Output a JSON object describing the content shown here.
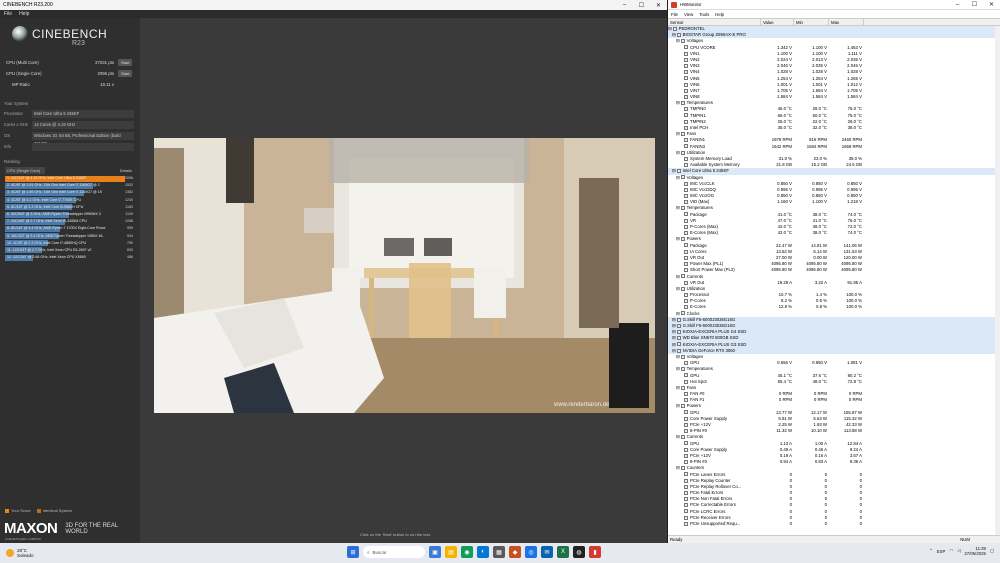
{
  "cinebench": {
    "title": "CINEBENCH R23.200",
    "menu": [
      "File",
      "Help"
    ],
    "logo": "CINEBENCH",
    "version": "R23",
    "multi": {
      "label": "CPU (Multi Core)",
      "value": "27031 pts",
      "btn": "Start"
    },
    "single": {
      "label": "CPU (Single Core)",
      "value": "2096 pts",
      "btn": "Start"
    },
    "ratio": {
      "label": "MP Ratio",
      "value": "10.11 x"
    },
    "system_label": "Your System",
    "system": [
      {
        "k": "Processor",
        "v": "Intel Core Ultra 5 245KF"
      },
      {
        "k": "Cores x GHz",
        "v": "14 Cores @ 4.19 GHz"
      },
      {
        "k": "OS",
        "v": "Windows 10, 64 Bit, Professional Edition (build 26100)"
      },
      {
        "k": "Info",
        "v": ""
      }
    ],
    "ranking_label": "Ranking",
    "ranking_dropdown": "CPU (Single Core)",
    "details": "Details",
    "ranking": [
      {
        "t": "1. 14C/14T @ 4.19 GHz, Intel Core Ultra 5 245KF",
        "s": "2096",
        "me": true,
        "f": 1.0
      },
      {
        "t": "2. 4C/8T @ 2.81 GHz, 11th Gen Intel Core i7-1165G7 @ 2",
        "s": "1532",
        "f": 0.73
      },
      {
        "t": "3. 4C/8T @ 1.69 GHz, 11th Gen Intel Core i7-1165G7 @ 15",
        "s": "1382",
        "f": 0.66
      },
      {
        "t": "4. 4C/8T @ 4.2 GHz, Intel Core i7-7700K CPU",
        "s": "1230",
        "f": 0.59
      },
      {
        "t": "5. 8C/16T @ 2.3 GHz, Intel Core i9-9880H CPU",
        "s": "1183",
        "f": 0.56
      },
      {
        "t": "6. 32C/64T @ 3 GHz, AMD Ryzen Threadripper 2990WX 3",
        "s": "1109",
        "f": 0.53
      },
      {
        "t": "7. 24C/48T @ 2.7 GHz, Intel Xeon W-3265M CPU",
        "s": "1058",
        "f": 0.5
      },
      {
        "t": "8. 8C/16T @ 3.4 GHz, AMD Ryzen 7 1700X Eight-Core Proce",
        "s": "959",
        "f": 0.46
      },
      {
        "t": "9. 16C/32T @ 3.4 GHz, AMD Ryzen Threadripper 1950X 16-",
        "s": "944",
        "f": 0.45
      },
      {
        "t": "10. 4C/8T @ 2.3 GHz, Intel Core i7-4850HQ CPU",
        "s": "750",
        "f": 0.36
      },
      {
        "t": "11. 12C/24T @ 2.7 GHz, Intel Xeon CPU E5-2697 v2",
        "s": "653",
        "f": 0.31
      },
      {
        "t": "12. 12C/24T @ 2.66 GHz, Intel Xeon CPU X5650",
        "s": "486",
        "f": 0.23
      }
    ],
    "legend": [
      "Your Score",
      "Identical System"
    ],
    "brand": "MAXON",
    "brand_sub": "A NEMETSCHEK COMPANY",
    "tagline": "3D FOR THE REAL WORLD",
    "hint": "Click on the 'Start' button to run the test.",
    "watermark": "www.renderbaron.de"
  },
  "hwmonitor": {
    "title": "HWMonitor",
    "menu": [
      "File",
      "View",
      "Tools",
      "Help"
    ],
    "columns": [
      "Sensor",
      "Value",
      "Min",
      "Max"
    ],
    "rows": [
      {
        "n": "PEDRONTEL",
        "l": 0,
        "dev": true
      },
      {
        "n": "BIOSTAR Group Z890AX-E PRO",
        "l": 1,
        "dev": true
      },
      {
        "n": "Voltages",
        "l": 2
      },
      {
        "n": "CPU VCORE",
        "l": 4,
        "a": "1.342 V",
        "b": "1.100 V",
        "c": "1.463 V"
      },
      {
        "n": "VIN1",
        "l": 4,
        "a": "1.100 V",
        "b": "1.100 V",
        "c": "1.111 V"
      },
      {
        "n": "VIN2",
        "l": 4,
        "a": "2.024 V",
        "b": "2.013 V",
        "c": "2.035 V"
      },
      {
        "n": "VIN3",
        "l": 4,
        "a": "2.046 V",
        "b": "2.035 V",
        "c": "2.046 V"
      },
      {
        "n": "VIN4",
        "l": 4,
        "a": "1.028 V",
        "b": "1.028 V",
        "c": "1.028 V"
      },
      {
        "n": "VIN5",
        "l": 4,
        "a": "1.254 V",
        "b": "1.254 V",
        "c": "1.265 V"
      },
      {
        "n": "VIN6",
        "l": 4,
        "a": "1.001 V",
        "b": "1.001 V",
        "c": "1.012 V"
      },
      {
        "n": "VIN7",
        "l": 4,
        "a": "1.705 V",
        "b": "1.694 V",
        "c": "1.705 V"
      },
      {
        "n": "VIN8",
        "l": 4,
        "a": "1.584 V",
        "b": "1.584 V",
        "c": "1.584 V"
      },
      {
        "n": "Temperatures",
        "l": 2
      },
      {
        "n": "TMPIN0",
        "l": 4,
        "a": "46.0 °C",
        "b": "28.0 °C",
        "c": "75.0 °C"
      },
      {
        "n": "TMPIN1",
        "l": 4,
        "a": "66.0 °C",
        "b": "60.0 °C",
        "c": "75.0 °C"
      },
      {
        "n": "TMPIN2",
        "l": 4,
        "a": "25.0 °C",
        "b": "22.0 °C",
        "c": "26.0 °C"
      },
      {
        "n": "Intel PCH",
        "l": 4,
        "a": "35.0 °C",
        "b": "32.0 °C",
        "c": "38.0 °C"
      },
      {
        "n": "Fans",
        "l": 2
      },
      {
        "n": "FANIN1",
        "l": 4,
        "a": "1978 RPM",
        "b": "816 RPM",
        "c": "2460 RPM"
      },
      {
        "n": "FANIN3",
        "l": 4,
        "a": "1642 RPM",
        "b": "1584 RPM",
        "c": "1658 RPM"
      },
      {
        "n": "Utilization",
        "l": 2
      },
      {
        "n": "System Memory Load",
        "l": 4,
        "a": "31.0 %",
        "b": "23.0 %",
        "c": "39.0 %"
      },
      {
        "n": "Available System Memory",
        "l": 4,
        "a": "21.8 GB",
        "b": "15.2 GB",
        "c": "24.6 GB"
      },
      {
        "n": "Intel Core Ultra 5 245KF",
        "l": 1,
        "dev": true
      },
      {
        "n": "Voltages",
        "l": 2
      },
      {
        "n": "IMC VccCLK",
        "l": 4,
        "a": "0.850 V",
        "b": "0.850 V",
        "c": "0.850 V"
      },
      {
        "n": "IMC VccDDQ",
        "l": 4,
        "a": "0.995 V",
        "b": "0.995 V",
        "c": "0.995 V"
      },
      {
        "n": "IMC VccIOG",
        "l": 4,
        "a": "0.850 V",
        "b": "0.850 V",
        "c": "0.850 V"
      },
      {
        "n": "VID (Max)",
        "l": 4,
        "a": "1.160 V",
        "b": "1.100 V",
        "c": "1.218 V"
      },
      {
        "n": "Temperatures",
        "l": 2
      },
      {
        "n": "Package",
        "l": 4,
        "a": "41.0 °C",
        "b": "38.0 °C",
        "c": "74.0 °C"
      },
      {
        "n": "VR",
        "l": 4,
        "a": "47.0 °C",
        "b": "41.0 °C",
        "c": "76.0 °C"
      },
      {
        "n": "P-Cores (Max)",
        "l": 4,
        "a": "42.0 °C",
        "b": "38.0 °C",
        "c": "72.0 °C"
      },
      {
        "n": "E-Cores (Max)",
        "l": 4,
        "a": "42.0 °C",
        "b": "38.0 °C",
        "c": "74.0 °C"
      },
      {
        "n": "Powers",
        "l": 2
      },
      {
        "n": "Package",
        "l": 4,
        "a": "22.47 W",
        "b": "14.81 W",
        "c": "141.06 W"
      },
      {
        "n": "IA Cores",
        "l": 4,
        "a": "13.52 W",
        "b": "6.14 W",
        "c": "131.63 W"
      },
      {
        "n": "VR Out",
        "l": 4,
        "a": "27.00 W",
        "b": "0.00 W",
        "c": "120.00 W"
      },
      {
        "n": "Power Max (PL1)",
        "l": 4,
        "a": "4095.80 W",
        "b": "4095.80 W",
        "c": "4095.80 W"
      },
      {
        "n": "Short Power Max (PL2)",
        "l": 4,
        "a": "4095.80 W",
        "b": "4095.80 W",
        "c": "4095.80 W"
      },
      {
        "n": "Currents",
        "l": 2
      },
      {
        "n": "VR Out",
        "l": 4,
        "a": "19.29 A",
        "b": "3.22 A",
        "c": "91.85 A"
      },
      {
        "n": "Utilization",
        "l": 2
      },
      {
        "n": "Processor",
        "l": 4,
        "a": "10.7 %",
        "b": "1.4 %",
        "c": "100.0 %"
      },
      {
        "n": "P-Cores",
        "l": 4,
        "a": "8.2 %",
        "b": "0.5 %",
        "c": "100.0 %"
      },
      {
        "n": "E-Cores",
        "l": 4,
        "a": "12.8 %",
        "b": "0.8 %",
        "c": "100.0 %"
      },
      {
        "n": "Clocks",
        "l": 2
      },
      {
        "n": "G.Skill F5-6000J3036G16G",
        "l": 1,
        "dev": true
      },
      {
        "n": "G.Skill F5-6000J3036G16G",
        "l": 1,
        "dev": true
      },
      {
        "n": "KIOXIA-EXCERIA PLUS G4 SSD",
        "l": 1,
        "dev": true
      },
      {
        "n": "WD Blue SN570 500GB SSD",
        "l": 1,
        "dev": true
      },
      {
        "n": "KIOXIA-EXCERIA PLUS G3 SSD",
        "l": 1,
        "dev": true
      },
      {
        "n": "NVIDIA GeForce RTX 3060",
        "l": 1,
        "dev": true
      },
      {
        "n": "Voltages",
        "l": 2
      },
      {
        "n": "GPU",
        "l": 4,
        "a": "0.656 V",
        "b": "0.650 V",
        "c": "1.081 V"
      },
      {
        "n": "Temperatures",
        "l": 2
      },
      {
        "n": "GPU",
        "l": 4,
        "a": "45.1 °C",
        "b": "37.6 °C",
        "c": "80.2 °C"
      },
      {
        "n": "Hot Spot",
        "l": 4,
        "a": "55.4 °C",
        "b": "48.0 °C",
        "c": "72.8 °C"
      },
      {
        "n": "Fans",
        "l": 2
      },
      {
        "n": "FAN #0",
        "l": 4,
        "a": "0 RPM",
        "b": "0 RPM",
        "c": "0 RPM"
      },
      {
        "n": "FAN #1",
        "l": 4,
        "a": "0 RPM",
        "b": "0 RPM",
        "c": "0 RPM"
      },
      {
        "n": "Powers",
        "l": 2
      },
      {
        "n": "GPU",
        "l": 4,
        "a": "13.77 W",
        "b": "12.17 W",
        "c": "155.87 W"
      },
      {
        "n": "Core Power Supply",
        "l": 4,
        "a": "5.91 W",
        "b": "5.63 W",
        "c": "115.32 W"
      },
      {
        "n": "PCIe +12V",
        "l": 4,
        "a": "2.25 W",
        "b": "1.93 W",
        "c": "42.33 W"
      },
      {
        "n": "8-PIN #0",
        "l": 4,
        "a": "11.32 W",
        "b": "10.10 W",
        "c": "113.88 W"
      },
      {
        "n": "Currents",
        "l": 2
      },
      {
        "n": "GPU",
        "l": 4,
        "a": "1.13 A",
        "b": "1.00 A",
        "c": "12.84 A"
      },
      {
        "n": "Core Power Supply",
        "l": 4,
        "a": "0.49 A",
        "b": "0.46 A",
        "c": "9.24 A"
      },
      {
        "n": "PCIe +12V",
        "l": 4,
        "a": "0.19 A",
        "b": "0.16 A",
        "c": "3.57 A"
      },
      {
        "n": "8-PIN #0",
        "l": 4,
        "a": "0.94 A",
        "b": "0.83 A",
        "c": "9.36 A"
      },
      {
        "n": "Counters",
        "l": 2
      },
      {
        "n": "PCIe Lanes Errors",
        "l": 4,
        "a": "0",
        "b": "0",
        "c": "0"
      },
      {
        "n": "PCIe Replay Counter",
        "l": 4,
        "a": "0",
        "b": "0",
        "c": "0"
      },
      {
        "n": "PCIe Replay Rollover Co...",
        "l": 4,
        "a": "0",
        "b": "0",
        "c": "0"
      },
      {
        "n": "PCIe Fatal Errors",
        "l": 4,
        "a": "0",
        "b": "0",
        "c": "0"
      },
      {
        "n": "PCIe Non Fatal Errors",
        "l": 4,
        "a": "0",
        "b": "0",
        "c": "0"
      },
      {
        "n": "PCIe Correctable Errors",
        "l": 4,
        "a": "0",
        "b": "0",
        "c": "0"
      },
      {
        "n": "PCIe LCRC Errors",
        "l": 4,
        "a": "0",
        "b": "0",
        "c": "0"
      },
      {
        "n": "PCIe Receiver Errors",
        "l": 4,
        "a": "0",
        "b": "0",
        "c": "0"
      },
      {
        "n": "PCIe Unsupported Requ...",
        "l": 4,
        "a": "0",
        "b": "0",
        "c": "0"
      }
    ],
    "status": "Ready",
    "numlock": "NUM"
  },
  "taskbar": {
    "temp": "28°C",
    "weather": "Soleado",
    "search": "Buscar",
    "lang": "ESP",
    "time": "11:39",
    "date": "27/06/2025"
  }
}
